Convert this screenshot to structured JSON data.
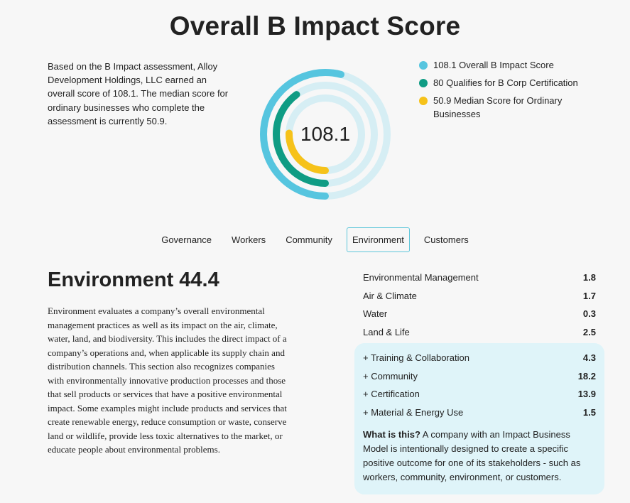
{
  "title": "Overall B Impact Score",
  "summary": "Based on the B Impact assessment, Alloy Development Holdings, LLC earned an overall score of 108.1. The median score for ordinary businesses who complete the assessment is currently 50.9.",
  "donut": {
    "center_value": "108.1",
    "track_color": "#d6eef4",
    "rings": [
      {
        "value": 108.1,
        "max": 200,
        "color": "#56c5df"
      },
      {
        "value": 80,
        "max": 200,
        "color": "#0f9c84"
      },
      {
        "value": 50.9,
        "max": 200,
        "color": "#f6c21a"
      }
    ]
  },
  "legend": [
    {
      "label": "108.1 Overall B Impact Score",
      "color": "#56c5df"
    },
    {
      "label": "80 Qualifies for B Corp Certification",
      "color": "#0f9c84"
    },
    {
      "label": "50.9 Median Score for Ordinary Businesses",
      "color": "#f6c21a"
    }
  ],
  "tabs": [
    {
      "label": "Governance",
      "active": false
    },
    {
      "label": "Workers",
      "active": false
    },
    {
      "label": "Community",
      "active": false
    },
    {
      "label": "Environment",
      "active": true
    },
    {
      "label": "Customers",
      "active": false
    }
  ],
  "section": {
    "title": "Environment 44.4",
    "description": "Environment evaluates a company’s overall environmental management practices as well as its impact on the air, climate, water, land, and biodiversity. This includes the direct impact of a company’s operations and, when applicable its supply chain and distribution channels. This section also recognizes companies with environmentally innovative production processes and those that sell products or services that have a positive environmental impact. Some examples might include products and services that create renewable energy, reduce consumption or waste, conserve land or wildlife, provide less toxic alternatives to the market, or educate people about environmental problems."
  },
  "scores": [
    {
      "label": "Environmental Management",
      "value": "1.8"
    },
    {
      "label": "Air & Climate",
      "value": "1.7"
    },
    {
      "label": "Water",
      "value": "0.3"
    },
    {
      "label": "Land & Life",
      "value": "2.5"
    }
  ],
  "impact_models": [
    {
      "label": "+ Training & Collaboration",
      "value": "4.3"
    },
    {
      "label": "+ Community",
      "value": "18.2"
    },
    {
      "label": "+ Certification",
      "value": "13.9"
    },
    {
      "label": "+ Material & Energy Use",
      "value": "1.5"
    }
  ],
  "what_is": {
    "heading": "What is this?",
    "text": " A company with an Impact Business Model is intentionally designed to create a specific positive outcome for one of its stakeholders - such as workers, community, environment, or customers."
  }
}
